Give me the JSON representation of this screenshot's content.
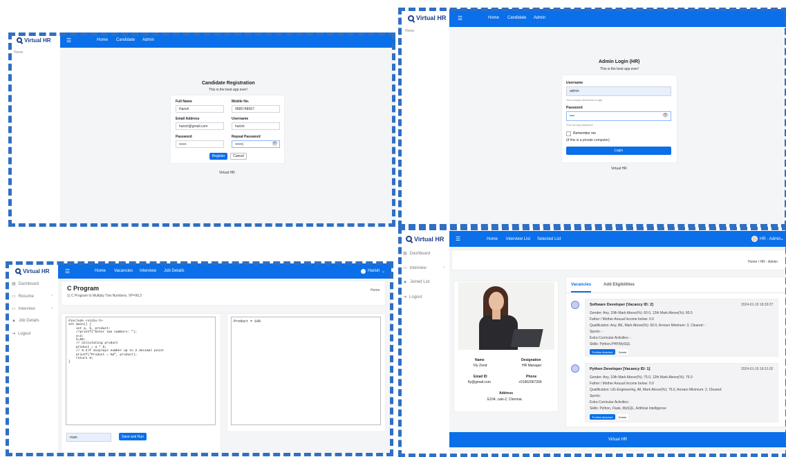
{
  "brand": "Virtual HR",
  "reg": {
    "nav": [
      "Home",
      "Candidate",
      "Admin"
    ],
    "side_home": "Home",
    "title": "Candidate Registration",
    "subtitle": "This is the best app ever!",
    "labels": {
      "fullname": "Full Name",
      "mobile": "Mobile No.",
      "email": "Email Address",
      "username": "Username",
      "password": "Password",
      "repeat": "Repeat Password"
    },
    "values": {
      "fullname": "Harish",
      "mobile": "9685748567",
      "email": "harish@gmail.com",
      "username": "harish",
      "password": "••••••",
      "repeat": "••••••|"
    },
    "register": "Register",
    "cancel": "Cancel",
    "footer": "Virtual HR"
  },
  "admin": {
    "nav": [
      "Home",
      "Candidate",
      "Admin"
    ],
    "side_home": "Home",
    "title": "Admin Login (HR)",
    "subtitle": "This is the best app ever!",
    "username_label": "Username",
    "username_value": "admin",
    "username_hint": "Your unique username to app",
    "password_label": "Password",
    "password_value": "••••",
    "password_hint": "Your strong password",
    "remember": "Remember me",
    "private": "(if this is a private computer)",
    "login": "Login",
    "footer": "Virtual HR"
  },
  "code": {
    "nav": [
      "Home",
      "Vacancies",
      "Interview",
      "Job Details"
    ],
    "user": "Harish",
    "side": [
      "Dashboard",
      "Resume",
      "Interview",
      "Job Details",
      "Logout"
    ],
    "title": "C Program",
    "desc": "1) C Program to Multiply Two Numbers, VP=90,2",
    "crumb": "Home",
    "source": "#include <stdio.h>\nint main() {\n    int a, b, product;\n    //printf(\"Enter two numbers: \");\n    a=2;\n    b=50;\n    // Calculating product\n    product = a * b;\n    // %.2lf displays number up to 2 decimal point\n    printf(\"Product = %d\", product);\n    return 0;\n}",
    "output": "Product = 100",
    "lang_value": "main",
    "run": "Save and Run"
  },
  "hr": {
    "nav": [
      "Home",
      "Interview List",
      "Selected List"
    ],
    "user": "HR - Admin",
    "side": [
      "Dashboard",
      "Interview",
      "Joined List",
      "Logout"
    ],
    "crumb": "Home / HR - Admin",
    "profile": {
      "name_label": "Name",
      "name": "Fly Zend",
      "desig_label": "Designation",
      "desig": "HR Manager",
      "email_label": "Email ID",
      "email": "fly@gmail.com",
      "phone_label": "Phone",
      "phone": "+01962067309",
      "addr_label": "Address",
      "addr": "E104, cain-2, Chennai."
    },
    "tabs": [
      "Vacancies",
      "Add Eligibilities"
    ],
    "vacancies": [
      {
        "title": "Software Developer [Vacancy ID: 2]",
        "date": "2024-01-19 18:39:27",
        "lines": [
          "Gender: Any, 10th Mark Above(%): 60.0, 12th Mark Above(%): 60.0",
          "Father / Mother Anuual Income below: 0.0",
          "Qualification: Any, BE, Mark Above(%): 60.0, Arrears Minimum: 3, Cleared: -",
          "Sports: -",
          "Extra Curricular Activities: -",
          "Skills: Python,PHP,MySQL"
        ],
        "matched": "Profiles Matched",
        "delete": "Delete"
      },
      {
        "title": "Python Developer [Vacancy ID: 1]",
        "date": "2024-01-19 18:31:02",
        "lines": [
          "Gender: Any, 10th Mark Above(%): 75.0, 12th Mark Above(%): 75.0",
          "Father / Mother Anuual Income below: 0.0",
          "Qualification: UG-Engineering, All, Mark Above(%): 75.0, Arrears Minimum: 2, Cleared:",
          "Sports:",
          "Extra Curricular Activities:",
          "Skills: Python, Flask, MySQL, Artificial Intelligence"
        ],
        "matched": "Profiles Matched",
        "delete": "Delete"
      }
    ],
    "footer": "Virtual HR"
  },
  "colors": {
    "primary": "#0a6fe8",
    "dash": "#2f6fc4"
  }
}
